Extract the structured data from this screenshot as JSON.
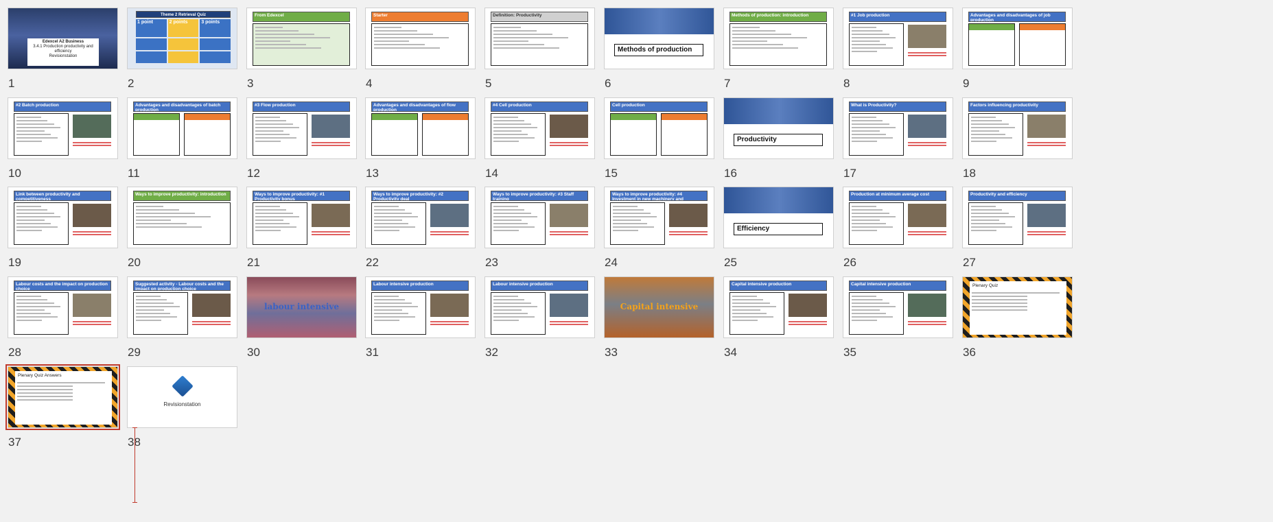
{
  "slide_sorter": {
    "slides": [
      {
        "num": "1",
        "kind": "cover",
        "title": "Edexcel A2 Business",
        "subtitle": "3.4.1 Production productivity and efficiency",
        "footer": "Revisionstation"
      },
      {
        "num": "2",
        "kind": "quiz",
        "title": "Theme 2 Retrieval Quiz",
        "cols": [
          "1 point",
          "2 points",
          "3 points"
        ]
      },
      {
        "num": "3",
        "kind": "text",
        "header": "From Edexcel",
        "color": "green"
      },
      {
        "num": "4",
        "kind": "text",
        "header": "Starter",
        "color": "orange"
      },
      {
        "num": "5",
        "kind": "text",
        "header": "Definition: Productivity",
        "color": "gray"
      },
      {
        "num": "6",
        "kind": "section",
        "title": "Methods of production"
      },
      {
        "num": "7",
        "kind": "text",
        "header": "Methods of production: introduction",
        "color": "green"
      },
      {
        "num": "8",
        "kind": "photo",
        "header": "#1 Job production",
        "color": "blue"
      },
      {
        "num": "9",
        "kind": "split",
        "header": "Advantages and disadvantages of job production",
        "color": "blue"
      },
      {
        "num": "10",
        "kind": "photo",
        "header": "#2 Batch production",
        "color": "blue"
      },
      {
        "num": "11",
        "kind": "split",
        "header": "Advantages and disadvantages of batch production",
        "color": "blue"
      },
      {
        "num": "12",
        "kind": "photo",
        "header": "#3 Flow production",
        "color": "blue"
      },
      {
        "num": "13",
        "kind": "split",
        "header": "Advantages and disadvantages of flow production",
        "color": "blue"
      },
      {
        "num": "14",
        "kind": "photo",
        "header": "#4 Cell production",
        "color": "blue"
      },
      {
        "num": "15",
        "kind": "split",
        "header": "Cell production",
        "color": "blue"
      },
      {
        "num": "16",
        "kind": "section",
        "title": "Productivity"
      },
      {
        "num": "17",
        "kind": "photo",
        "header": "What is Productivity?",
        "color": "blue"
      },
      {
        "num": "18",
        "kind": "photo",
        "header": "Factors influencing productivity",
        "color": "blue"
      },
      {
        "num": "19",
        "kind": "photo",
        "header": "Link between productivity and competitiveness",
        "color": "blue"
      },
      {
        "num": "20",
        "kind": "text",
        "header": "Ways to improve productivity: introduction",
        "color": "green"
      },
      {
        "num": "21",
        "kind": "photo",
        "header": "Ways to improve productivity: #1 Productivity bonus",
        "color": "blue"
      },
      {
        "num": "22",
        "kind": "photo",
        "header": "Ways to improve productivity: #2 Productivity deal",
        "color": "blue"
      },
      {
        "num": "23",
        "kind": "photo",
        "header": "Ways to improve productivity: #3 Staff training",
        "color": "blue"
      },
      {
        "num": "24",
        "kind": "photo",
        "header": "Ways to improve productivity: #4 Investment in new machinery and equipment",
        "color": "blue"
      },
      {
        "num": "25",
        "kind": "section",
        "title": "Efficiency"
      },
      {
        "num": "26",
        "kind": "photo",
        "header": "Production at minimum average cost",
        "color": "blue"
      },
      {
        "num": "27",
        "kind": "photo",
        "header": "Productivity and efficiency",
        "color": "blue"
      },
      {
        "num": "28",
        "kind": "photo",
        "header": "Labour costs and the impact on production choice",
        "color": "blue"
      },
      {
        "num": "29",
        "kind": "photo",
        "header": "Suggested activity - Labour costs and the impact on production choice",
        "color": "blue"
      },
      {
        "num": "30",
        "kind": "image",
        "title": "labour intensive"
      },
      {
        "num": "31",
        "kind": "photo",
        "header": "Labour intensive production",
        "color": "blue"
      },
      {
        "num": "32",
        "kind": "photo",
        "header": "Labour intensive production",
        "color": "blue"
      },
      {
        "num": "33",
        "kind": "image",
        "title": "Capital intensive"
      },
      {
        "num": "34",
        "kind": "photo",
        "header": "Capital intensive production",
        "color": "blue"
      },
      {
        "num": "35",
        "kind": "photo",
        "header": "Capital intensive production",
        "color": "blue"
      },
      {
        "num": "36",
        "kind": "plenary",
        "header": "Plenary Quiz"
      },
      {
        "num": "37",
        "kind": "plenary",
        "header": "Plenary Quiz Answers"
      },
      {
        "num": "38",
        "kind": "logo",
        "title": "Revisionstation"
      }
    ]
  }
}
